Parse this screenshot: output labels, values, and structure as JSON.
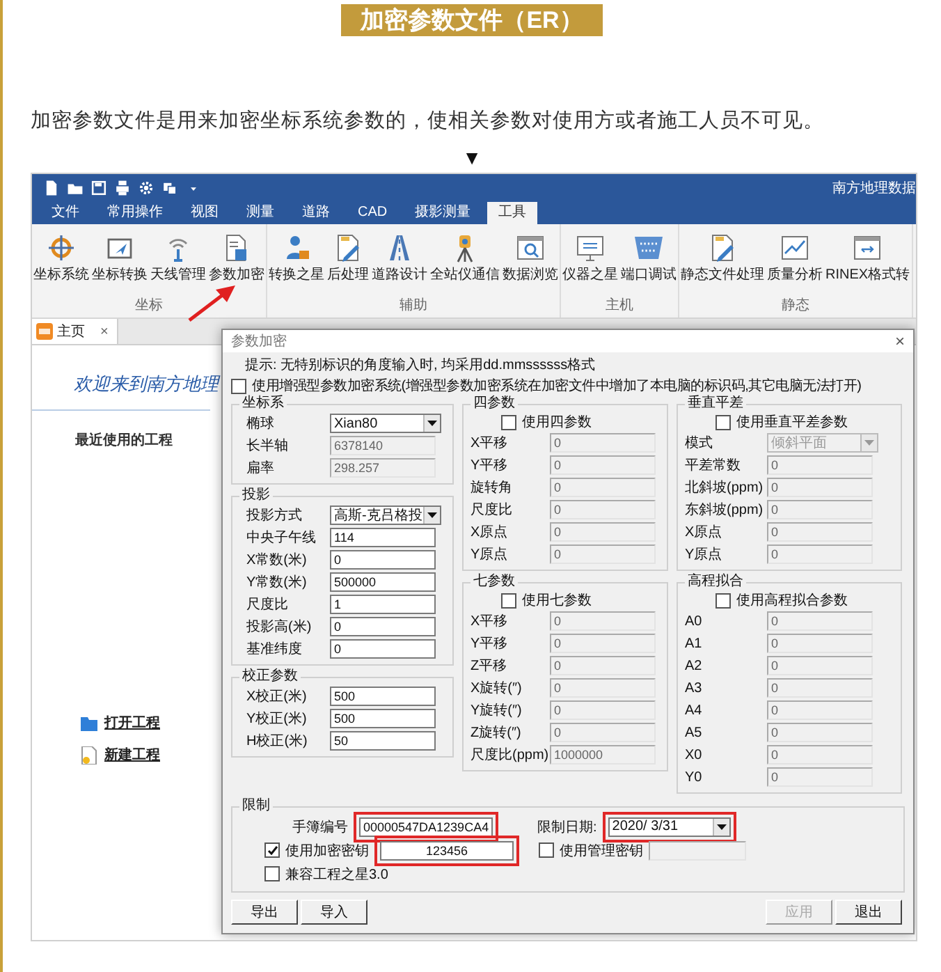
{
  "banner": {
    "title": "加密参数文件（ER）"
  },
  "intro": "加密参数文件是用来加密坐标系统参数的，使相关参数对使用方或者施工人员不可见。",
  "pointer": "▼",
  "app": {
    "title": "南方地理数据",
    "menu_tabs": [
      {
        "label": "文件",
        "selected": false
      },
      {
        "label": "常用操作",
        "selected": false
      },
      {
        "label": "视图",
        "selected": false
      },
      {
        "label": "测量",
        "selected": false
      },
      {
        "label": "道路",
        "selected": false
      },
      {
        "label": "CAD",
        "selected": false
      },
      {
        "label": "摄影测量",
        "selected": false
      },
      {
        "label": "工具",
        "selected": true
      }
    ],
    "ribbon_groups": [
      {
        "name": "坐标",
        "tools": [
          "坐标系统",
          "坐标转换",
          "天线管理",
          "参数加密"
        ]
      },
      {
        "name": "辅助",
        "tools": [
          "转换之星",
          "后处理",
          "道路设计",
          "全站仪通信",
          "数据浏览"
        ]
      },
      {
        "name": "主机",
        "tools": [
          "仪器之星",
          "端口调试"
        ]
      },
      {
        "name": "静态",
        "tools": [
          "静态文件处理",
          "质量分析",
          "RINEX格式转"
        ]
      }
    ],
    "doc_tab": {
      "label": "主页",
      "close": "×"
    },
    "home": {
      "welcome": "欢迎来到南方地理",
      "recent_heading": "最近使用的工程",
      "links": [
        "打开工程",
        "新建工程"
      ]
    },
    "dialog": {
      "title": "参数加密",
      "close": "×",
      "hint": "提示: 无特别标识的角度输入时, 均采用dd.mmssssss格式",
      "enhanced": {
        "label": "使用增强型参数加密系统(增强型参数加密系统在加密文件中增加了本电脑的标识码,其它电脑无法打开)",
        "checked": false
      },
      "columns": [
        [
          {
            "title": "坐标系",
            "fields": [
              {
                "label": "椭球",
                "value": "Xian80",
                "kind": "select",
                "disabled": false
              },
              {
                "label": "长半轴",
                "value": "6378140",
                "kind": "text",
                "disabled": true
              },
              {
                "label": "扁率",
                "value": "298.257",
                "kind": "text",
                "disabled": true
              }
            ]
          },
          {
            "title": "投影",
            "fields": [
              {
                "label": "投影方式",
                "value": "高斯-克吕格投",
                "kind": "select",
                "disabled": false
              },
              {
                "label": "中央子午线",
                "value": "114",
                "kind": "text",
                "disabled": false
              },
              {
                "label": "X常数(米)",
                "value": "0",
                "kind": "text",
                "disabled": false
              },
              {
                "label": "Y常数(米)",
                "value": "500000",
                "kind": "text",
                "disabled": false
              },
              {
                "label": "尺度比",
                "value": "1",
                "kind": "text",
                "disabled": false
              },
              {
                "label": "投影高(米)",
                "value": "0",
                "kind": "text",
                "disabled": false
              },
              {
                "label": "基准纬度",
                "value": "0",
                "kind": "text",
                "disabled": false
              }
            ]
          },
          {
            "title": "校正参数",
            "fields": [
              {
                "label": "X校正(米)",
                "value": "500",
                "kind": "text",
                "disabled": false
              },
              {
                "label": "Y校正(米)",
                "value": "500",
                "kind": "text",
                "disabled": false
              },
              {
                "label": "H校正(米)",
                "value": "50",
                "kind": "text",
                "disabled": false
              }
            ]
          }
        ],
        [
          {
            "title": "四参数",
            "toggle": {
              "label": "使用四参数",
              "checked": false
            },
            "fields": [
              {
                "label": "X平移",
                "value": "0",
                "kind": "text",
                "disabled": true
              },
              {
                "label": "Y平移",
                "value": "0",
                "kind": "text",
                "disabled": true
              },
              {
                "label": "旋转角",
                "value": "0",
                "kind": "text",
                "disabled": true
              },
              {
                "label": "尺度比",
                "value": "0",
                "kind": "text",
                "disabled": true
              },
              {
                "label": "X原点",
                "value": "0",
                "kind": "text",
                "disabled": true
              },
              {
                "label": "Y原点",
                "value": "0",
                "kind": "text",
                "disabled": true
              }
            ]
          },
          {
            "title": "七参数",
            "toggle": {
              "label": "使用七参数",
              "checked": false
            },
            "fields": [
              {
                "label": "X平移",
                "value": "0",
                "kind": "text",
                "disabled": true
              },
              {
                "label": "Y平移",
                "value": "0",
                "kind": "text",
                "disabled": true
              },
              {
                "label": "Z平移",
                "value": "0",
                "kind": "text",
                "disabled": true
              },
              {
                "label": "X旋转(″)",
                "value": "0",
                "kind": "text",
                "disabled": true
              },
              {
                "label": "Y旋转(″)",
                "value": "0",
                "kind": "text",
                "disabled": true
              },
              {
                "label": "Z旋转(″)",
                "value": "0",
                "kind": "text",
                "disabled": true
              },
              {
                "label": "尺度比(ppm)",
                "value": "1000000",
                "kind": "text",
                "disabled": true
              }
            ]
          }
        ],
        [
          {
            "title": "垂直平差",
            "toggle": {
              "label": "使用垂直平差参数",
              "checked": false
            },
            "fields": [
              {
                "label": "模式",
                "value": "倾斜平面",
                "kind": "select",
                "disabled": true
              },
              {
                "label": "平差常数",
                "value": "0",
                "kind": "text",
                "disabled": true
              },
              {
                "label": "北斜坡(ppm)",
                "value": "0",
                "kind": "text",
                "disabled": true
              },
              {
                "label": "东斜坡(ppm)",
                "value": "0",
                "kind": "text",
                "disabled": true
              },
              {
                "label": "X原点",
                "value": "0",
                "kind": "text",
                "disabled": true
              },
              {
                "label": "Y原点",
                "value": "0",
                "kind": "text",
                "disabled": true
              }
            ]
          },
          {
            "title": "高程拟合",
            "toggle": {
              "label": "使用高程拟合参数",
              "checked": false
            },
            "fields": [
              {
                "label": "A0",
                "value": "0",
                "kind": "text",
                "disabled": true
              },
              {
                "label": "A1",
                "value": "0",
                "kind": "text",
                "disabled": true
              },
              {
                "label": "A2",
                "value": "0",
                "kind": "text",
                "disabled": true
              },
              {
                "label": "A3",
                "value": "0",
                "kind": "text",
                "disabled": true
              },
              {
                "label": "A4",
                "value": "0",
                "kind": "text",
                "disabled": true
              },
              {
                "label": "A5",
                "value": "0",
                "kind": "text",
                "disabled": true
              },
              {
                "label": "X0",
                "value": "0",
                "kind": "text",
                "disabled": true
              },
              {
                "label": "Y0",
                "value": "0",
                "kind": "text",
                "disabled": true
              }
            ]
          }
        ]
      ],
      "limits": {
        "title": "限制",
        "device": {
          "label": "手簿编号",
          "value": "00000547DA1239CA4",
          "highlighted": true
        },
        "expiry": {
          "label": "限制日期:",
          "value": "2020/ 3/31",
          "highlighted": true
        },
        "encrypt_key": {
          "label": "使用加密密钥",
          "checked": true,
          "value": "123456",
          "highlighted": true
        },
        "admin_key": {
          "label": "使用管理密钥",
          "checked": false
        },
        "compat": {
          "label": "兼容工程之星3.0",
          "checked": false
        }
      },
      "left_buttons": [
        {
          "label": "导出",
          "disabled": false
        },
        {
          "label": "导入",
          "disabled": false
        }
      ],
      "right_buttons": [
        {
          "label": "应用",
          "disabled": true
        },
        {
          "label": "退出",
          "disabled": false
        }
      ]
    }
  }
}
